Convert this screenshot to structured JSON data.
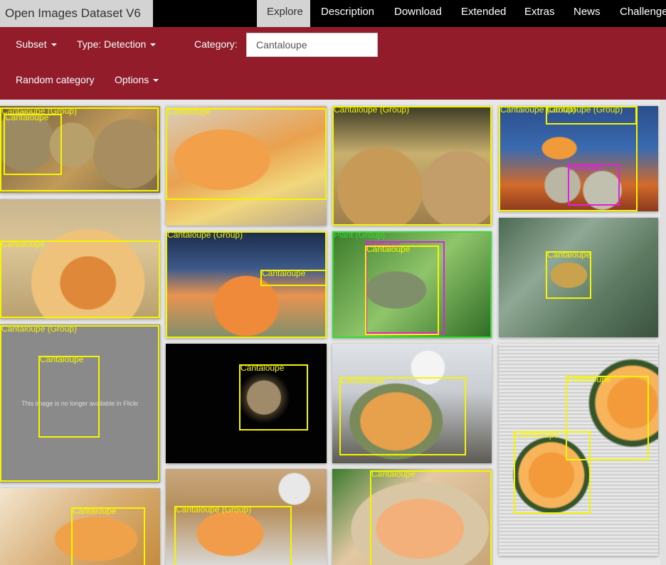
{
  "app": {
    "title": "Open Images Dataset V6"
  },
  "nav": {
    "tabs": [
      {
        "label": "Explore",
        "active": true
      },
      {
        "label": "Description",
        "active": false
      },
      {
        "label": "Download",
        "active": false
      },
      {
        "label": "Extended",
        "active": false
      },
      {
        "label": "Extras",
        "active": false
      },
      {
        "label": "News",
        "active": false
      },
      {
        "label": "Challenge",
        "active": false
      }
    ]
  },
  "toolbar": {
    "subset_label": "Subset",
    "type_label": "Type: Detection",
    "category_label": "Category:",
    "category_value": "Cantaloupe",
    "random_label": "Random category",
    "options_label": "Options"
  },
  "colors": {
    "toolbar_bg": "#931c2a",
    "box_primary": "#f5f500",
    "box_plant": "#33dd33",
    "box_other": "#e020e0"
  },
  "gallery": {
    "unavailable_text": "This image is no longer available in Flickr",
    "images": [
      {
        "labels": [
          "Cantaloupe (Group)",
          "Cantaloupe"
        ]
      },
      {
        "labels": [
          "Cantaloupe"
        ]
      },
      {
        "labels": [
          "Cantaloupe (Group)"
        ]
      },
      {
        "labels": [
          "Cantaloupe (Group)",
          "Cantaloupe (Group)",
          "Pumpkin"
        ]
      },
      {
        "labels": [
          "Cantaloupe"
        ]
      },
      {
        "labels": [
          "Cantaloupe (Group)",
          "Cantaloupe"
        ]
      },
      {
        "labels": [
          "Plant (Group)",
          "Pumpkin",
          "Cantaloupe"
        ]
      },
      {
        "labels": [
          "Cantaloupe"
        ]
      },
      {
        "labels": [
          "Cantaloupe (Group)",
          "Cantaloupe"
        ],
        "unavailable": true
      },
      {
        "labels": [
          "Cantaloupe"
        ]
      },
      {
        "labels": [
          "Cantaloupe"
        ]
      },
      {
        "labels": [
          "Cantaloupe",
          "Cantaloupe"
        ]
      },
      {
        "labels": [
          "Cantaloupe"
        ]
      },
      {
        "labels": [
          "Cantaloupe (Group)"
        ]
      },
      {
        "labels": [
          "Cantaloupe"
        ]
      }
    ]
  }
}
